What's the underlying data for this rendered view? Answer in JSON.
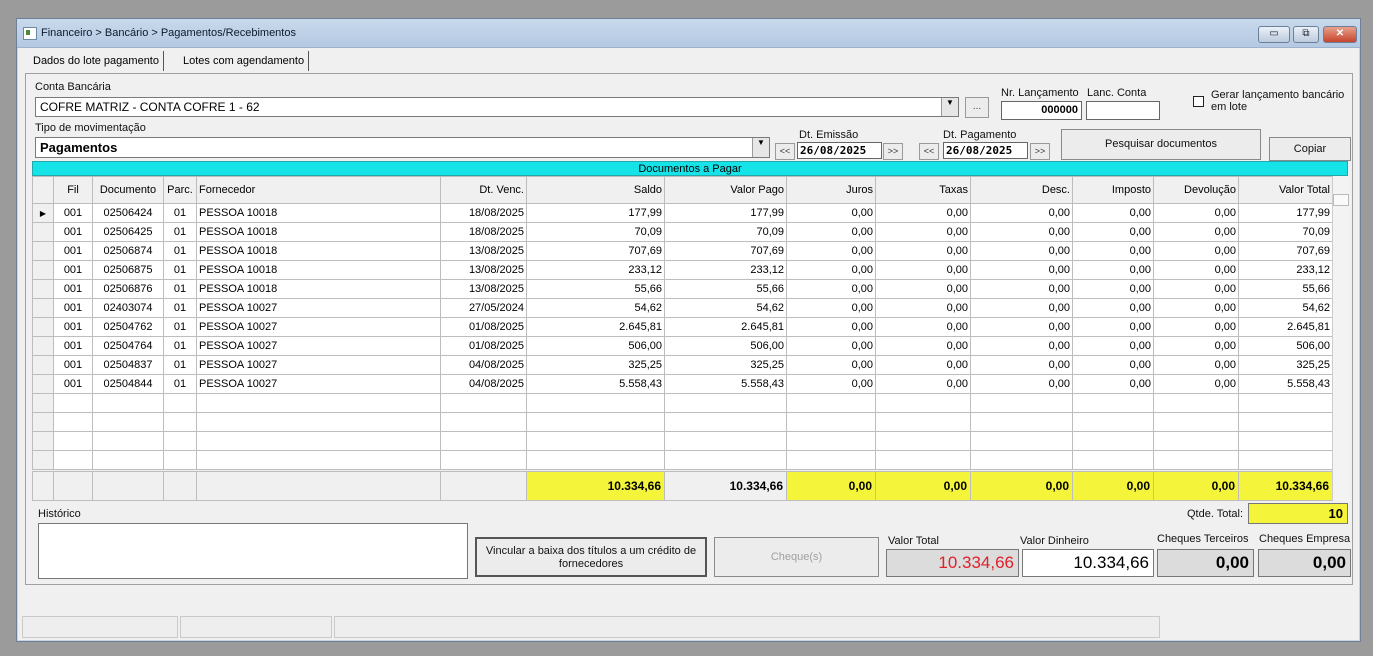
{
  "window": {
    "title": "Financeiro > Bancário > Pagamentos/Recebimentos",
    "controls": {
      "minimize": "▭",
      "restore": "⧉",
      "close": "✕"
    }
  },
  "tabs": [
    "Dados do lote pagamento",
    "Lotes com agendamento"
  ],
  "header": {
    "conta_bancaria_label": "Conta Bancária",
    "conta_bancaria_value": "COFRE MATRIZ - CONTA COFRE 1 - 62",
    "ellipsis_button": "...",
    "nr_lancamento_label": "Nr. Lançamento",
    "nr_lancamento_value": "000000",
    "lanc_conta_label": "Lanc. Conta",
    "lanc_conta_value": "",
    "gerar_lancamento_label": "Gerar lançamento bancário em lote",
    "tipo_mov_label": "Tipo de movimentação",
    "tipo_mov_value": "Pagamentos",
    "dt_emissao_label": "Dt. Emissão",
    "dt_emissao_value": "26/08/2025",
    "dt_pagamento_label": "Dt. Pagamento",
    "dt_pagamento_value": "26/08/2025",
    "prev_label": "<<",
    "next_label": ">>",
    "pesquisar_button": "Pesquisar documentos",
    "copiar_button": "Copiar"
  },
  "grid": {
    "title": "Documentos a Pagar",
    "columns": [
      "Fil",
      "Documento",
      "Parc.",
      "Fornecedor",
      "Dt. Venc.",
      "Saldo",
      "Valor Pago",
      "Juros",
      "Taxas",
      "Desc.",
      "Imposto",
      "Devolução",
      "Valor Total"
    ],
    "rows": [
      [
        "001",
        "02506424",
        "01",
        "PESSOA 10018",
        "18/08/2025",
        "177,99",
        "177,99",
        "0,00",
        "0,00",
        "0,00",
        "0,00",
        "0,00",
        "177,99"
      ],
      [
        "001",
        "02506425",
        "01",
        "PESSOA 10018",
        "18/08/2025",
        "70,09",
        "70,09",
        "0,00",
        "0,00",
        "0,00",
        "0,00",
        "0,00",
        "70,09"
      ],
      [
        "001",
        "02506874",
        "01",
        "PESSOA 10018",
        "13/08/2025",
        "707,69",
        "707,69",
        "0,00",
        "0,00",
        "0,00",
        "0,00",
        "0,00",
        "707,69"
      ],
      [
        "001",
        "02506875",
        "01",
        "PESSOA 10018",
        "13/08/2025",
        "233,12",
        "233,12",
        "0,00",
        "0,00",
        "0,00",
        "0,00",
        "0,00",
        "233,12"
      ],
      [
        "001",
        "02506876",
        "01",
        "PESSOA 10018",
        "13/08/2025",
        "55,66",
        "55,66",
        "0,00",
        "0,00",
        "0,00",
        "0,00",
        "0,00",
        "55,66"
      ],
      [
        "001",
        "02403074",
        "01",
        "PESSOA 10027",
        "27/05/2024",
        "54,62",
        "54,62",
        "0,00",
        "0,00",
        "0,00",
        "0,00",
        "0,00",
        "54,62"
      ],
      [
        "001",
        "02504762",
        "01",
        "PESSOA 10027",
        "01/08/2025",
        "2.645,81",
        "2.645,81",
        "0,00",
        "0,00",
        "0,00",
        "0,00",
        "0,00",
        "2.645,81"
      ],
      [
        "001",
        "02504764",
        "01",
        "PESSOA 10027",
        "01/08/2025",
        "506,00",
        "506,00",
        "0,00",
        "0,00",
        "0,00",
        "0,00",
        "0,00",
        "506,00"
      ],
      [
        "001",
        "02504837",
        "01",
        "PESSOA 10027",
        "04/08/2025",
        "325,25",
        "325,25",
        "0,00",
        "0,00",
        "0,00",
        "0,00",
        "0,00",
        "325,25"
      ],
      [
        "001",
        "02504844",
        "01",
        "PESSOA 10027",
        "04/08/2025",
        "5.558,43",
        "5.558,43",
        "0,00",
        "0,00",
        "0,00",
        "0,00",
        "0,00",
        "5.558,43"
      ]
    ],
    "selected_row_marker": "▶",
    "totals": [
      "10.334,66",
      "10.334,66",
      "0,00",
      "0,00",
      "0,00",
      "0,00",
      "0,00",
      "10.334,66"
    ]
  },
  "footer": {
    "historico_label": "Histórico",
    "historico_value": "",
    "qtde_total_label": "Qtde. Total:",
    "qtde_total_value": "10",
    "vincular_button": "Vincular a baixa dos títulos a um crédito de fornecedores",
    "cheques_button": "Cheque(s)",
    "valor_total_label": "Valor Total",
    "valor_total_value": "10.334,66",
    "valor_dinheiro_label": "Valor Dinheiro",
    "valor_dinheiro_value": "10.334,66",
    "cheques_terceiros_label": "Cheques Terceiros",
    "cheques_terceiros_value": "0,00",
    "cheques_empresa_label": "Cheques Empresa",
    "cheques_empresa_value": "0,00"
  },
  "colors": {
    "grid_title_bg": "#16e3e8",
    "totals_bg": "#f4f43a",
    "valor_total_fg": "#e0202a"
  }
}
